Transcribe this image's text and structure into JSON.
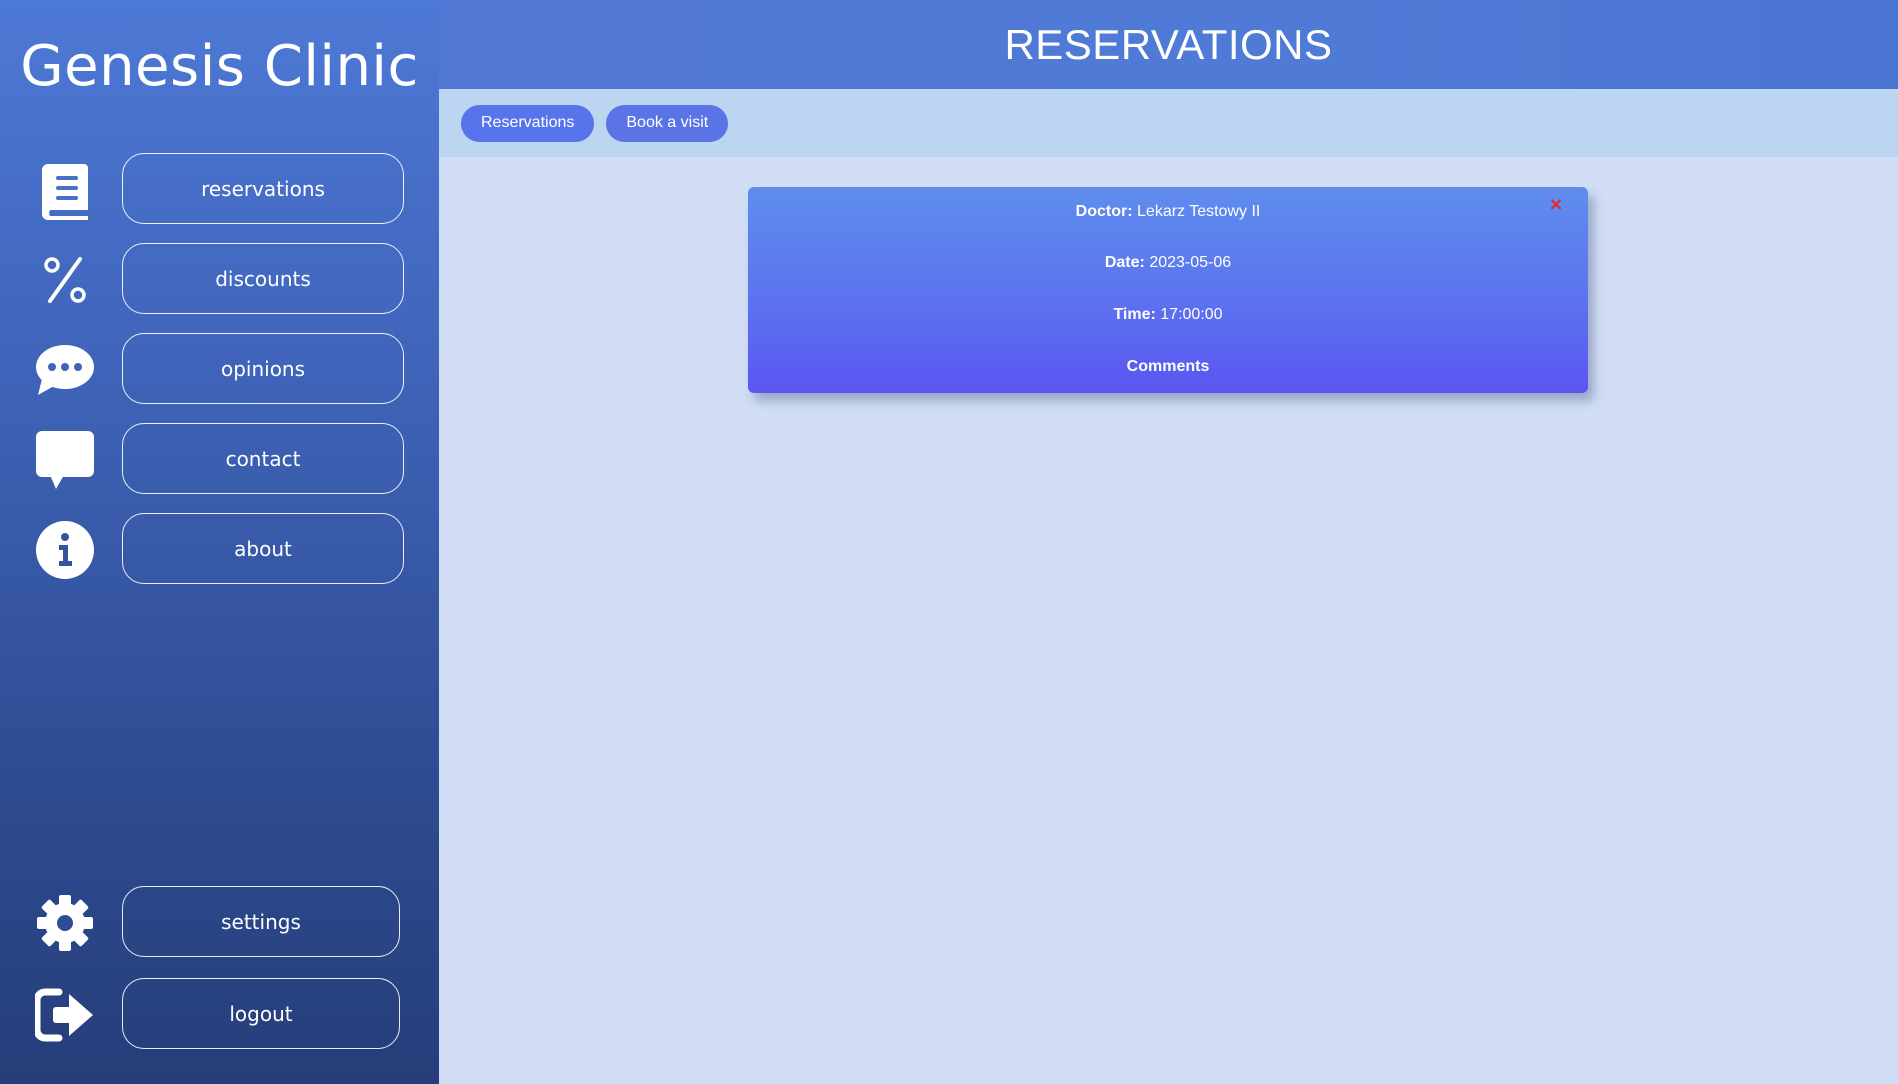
{
  "sidebar": {
    "brand": "Genesis Clinic",
    "items": [
      {
        "label": "reservations",
        "icon": "book-icon"
      },
      {
        "label": "discounts",
        "icon": "percent-icon"
      },
      {
        "label": "opinions",
        "icon": "chat-bubble-icon"
      },
      {
        "label": "contact",
        "icon": "message-icon"
      },
      {
        "label": "about",
        "icon": "info-icon"
      }
    ],
    "bottom_items": [
      {
        "label": "settings",
        "icon": "gear-icon"
      },
      {
        "label": "logout",
        "icon": "logout-icon"
      }
    ]
  },
  "header": {
    "title": "RESERVATIONS"
  },
  "tabs": [
    {
      "label": "Reservations"
    },
    {
      "label": "Book a visit"
    }
  ],
  "reservation": {
    "doctor_label": "Doctor:",
    "doctor_value": "Lekarz Testowy II",
    "date_label": "Date:",
    "date_value": "2023-05-06",
    "time_label": "Time:",
    "time_value": "17:00:00",
    "comments_label": "Comments",
    "close_symbol": "×"
  },
  "colors": {
    "sidebar_top": "#4d79d6",
    "sidebar_bottom": "#263d79",
    "topbar": "#4f7ad6",
    "tabbar": "#bcd6f2",
    "content_bg": "#d0ddf5",
    "card_top": "#5e8ded",
    "card_bottom": "#5a55f0",
    "tab_button": "#5a74e6",
    "close": "#e6262b"
  }
}
